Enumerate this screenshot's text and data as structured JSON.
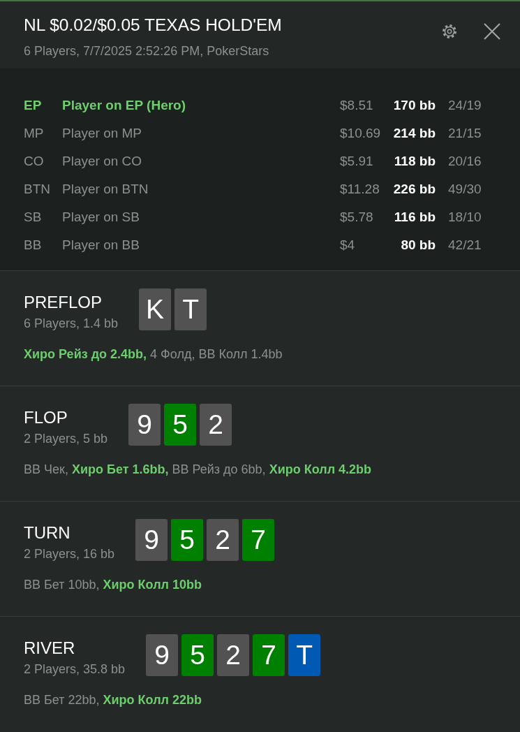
{
  "header": {
    "title": "NL $0.02/$0.05 TEXAS HOLD'EM",
    "subtitle": "6 Players, 7/7/2025 2:52:26 PM, PokerStars"
  },
  "players": [
    {
      "position": "EP",
      "name": "Player on EP (Hero)",
      "stack": "$8.51",
      "stack_bb": "170 bb",
      "stats": "24/19",
      "hero": true
    },
    {
      "position": "MP",
      "name": "Player on MP",
      "stack": "$10.69",
      "stack_bb": "214 bb",
      "stats": "21/15",
      "hero": false
    },
    {
      "position": "CO",
      "name": "Player on CO",
      "stack": "$5.91",
      "stack_bb": "118 bb",
      "stats": "20/16",
      "hero": false
    },
    {
      "position": "BTN",
      "name": "Player on BTN",
      "stack": "$11.28",
      "stack_bb": "226 bb",
      "stats": "49/30",
      "hero": false
    },
    {
      "position": "SB",
      "name": "Player on SB",
      "stack": "$5.78",
      "stack_bb": "116 bb",
      "stats": "18/10",
      "hero": false
    },
    {
      "position": "BB",
      "name": "Player on BB",
      "stack": "$4",
      "stack_bb": "80 bb",
      "stats": "42/21",
      "hero": false
    }
  ],
  "streets": [
    {
      "name": "PREFLOP",
      "info": "6 Players, 1.4 bb",
      "cards": [
        {
          "rank": "K",
          "color": "#525252"
        },
        {
          "rank": "T",
          "color": "#525252"
        }
      ],
      "actions": "**Хиро Рейз до 2.4bb,** 4 Фолд, BB Колл 1.4bb"
    },
    {
      "name": "FLOP",
      "info": "2 Players, 5 bb",
      "cards": [
        {
          "rank": "9",
          "color": "#525252"
        },
        {
          "rank": "5",
          "color": "#008000"
        },
        {
          "rank": "2",
          "color": "#525252"
        }
      ],
      "actions": "BB Чек, **Хиро Бет 1.6bb,** BB Рейз до 6bb, **Хиро Колл 4.2bb**"
    },
    {
      "name": "TURN",
      "info": "2 Players, 16 bb",
      "cards": [
        {
          "rank": "9",
          "color": "#525252"
        },
        {
          "rank": "5",
          "color": "#008000"
        },
        {
          "rank": "2",
          "color": "#525252"
        },
        {
          "rank": "7",
          "color": "#008000"
        }
      ],
      "actions": "BB Бет 10bb, **Хиро Колл 10bb**"
    },
    {
      "name": "RIVER",
      "info": "2 Players, 35.8 bb",
      "cards": [
        {
          "rank": "9",
          "color": "#525252"
        },
        {
          "rank": "5",
          "color": "#008000"
        },
        {
          "rank": "2",
          "color": "#525252"
        },
        {
          "rank": "7",
          "color": "#008000"
        },
        {
          "rank": "T",
          "color": "#0059b3"
        }
      ],
      "actions": "BB Бет 22bb, **Хиро Колл 22bb**"
    }
  ]
}
